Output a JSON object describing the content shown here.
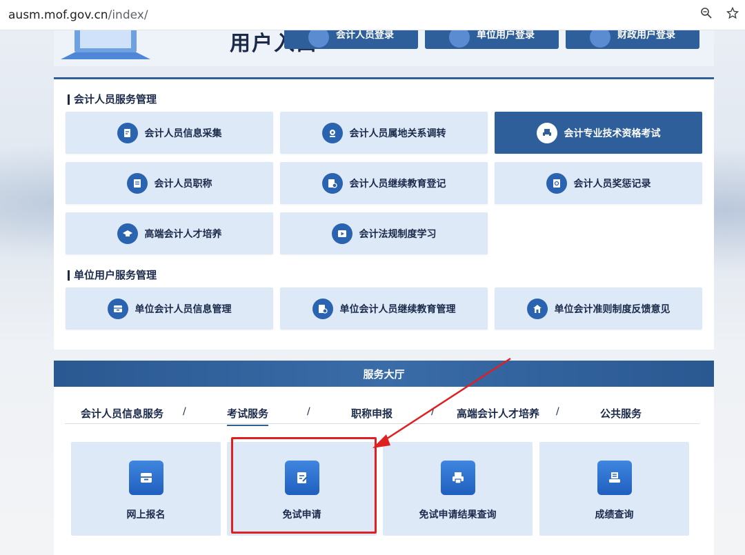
{
  "browser": {
    "url_host": "ausm.mof.gov.cn",
    "url_path": "/index/",
    "zoom_icon": "zoom-icon",
    "bookmark_icon": "star-icon"
  },
  "login": {
    "title": "用户入口",
    "buttons": [
      {
        "label": "会计人员登录"
      },
      {
        "label": "单位用户登录"
      },
      {
        "label": "财政用户登录"
      }
    ]
  },
  "accountant_section": {
    "title": "会计人员服务管理",
    "tiles": [
      {
        "label": "会计人员信息采集",
        "icon": "edit-doc-icon"
      },
      {
        "label": "会计人员属地关系调转",
        "icon": "location-icon"
      },
      {
        "label": "会计专业技术资格考试",
        "icon": "printer-icon",
        "active": true
      },
      {
        "label": "会计人员职称",
        "icon": "doc-icon"
      },
      {
        "label": "会计人员继续教育登记",
        "icon": "doc-search-icon"
      },
      {
        "label": "会计人员奖惩记录",
        "icon": "record-icon"
      },
      {
        "label": "高端会计人才培养",
        "icon": "graduation-icon"
      },
      {
        "label": "会计法规制度学习",
        "icon": "play-icon"
      }
    ]
  },
  "unit_section": {
    "title": "单位用户服务管理",
    "tiles": [
      {
        "label": "单位会计人员信息管理",
        "icon": "tray-icon"
      },
      {
        "label": "单位会计人员继续教育管理",
        "icon": "doc-search-icon"
      },
      {
        "label": "单位会计准则制度反馈意见",
        "icon": "home-icon"
      }
    ]
  },
  "hall": {
    "title": "服务大厅",
    "tabs": [
      {
        "label": "会计人员信息服务"
      },
      {
        "label": "考试服务",
        "active": true
      },
      {
        "label": "职称申报"
      },
      {
        "label": "高端会计人才培养"
      },
      {
        "label": "公共服务"
      }
    ],
    "separator": "/",
    "cards": [
      {
        "label": "网上报名",
        "icon": "tray-icon"
      },
      {
        "label": "免试申请",
        "icon": "edit-doc-icon"
      },
      {
        "label": "免试申请结果查询",
        "icon": "printer-icon"
      },
      {
        "label": "成绩查询",
        "icon": "printer-icon"
      }
    ]
  },
  "colors": {
    "primary": "#2f5f9a",
    "tile_bg": "#dde9f7",
    "annotation_red": "#e02020"
  }
}
